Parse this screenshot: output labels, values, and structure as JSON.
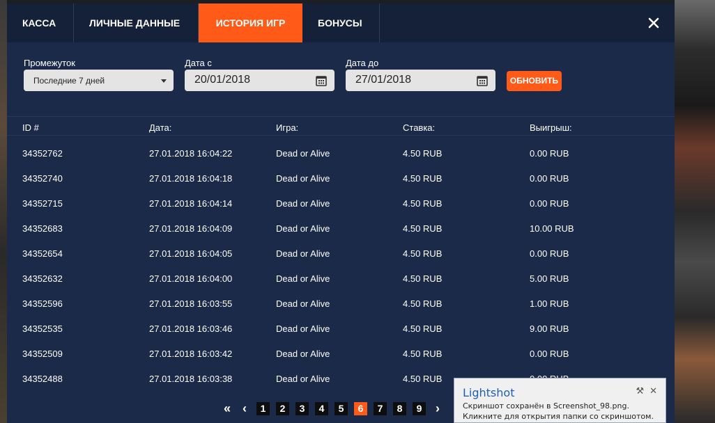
{
  "tabs": [
    {
      "label": "КАССА"
    },
    {
      "label": "ЛИЧНЫЕ ДАННЫЕ"
    },
    {
      "label": "ИСТОРИЯ ИГР"
    },
    {
      "label": "БОНУСЫ"
    }
  ],
  "active_tab": "ИСТОРИЯ ИГР",
  "filters": {
    "period_label": "Промежуток",
    "period_value": "Последние 7 дней",
    "date_from_label": "Дата с",
    "date_from_value": "20/01/2018",
    "date_to_label": "Дата до",
    "date_to_value": "27/01/2018",
    "refresh_label": "ОБНОВИТЬ"
  },
  "table": {
    "headers": [
      "ID #",
      "Дата:",
      "Игра:",
      "Ставка:",
      "Выигрыш:"
    ],
    "rows": [
      [
        "34352762",
        "27.01.2018 16:04:22",
        "Dead or Alive",
        "4.50 RUB",
        "0.00 RUB"
      ],
      [
        "34352740",
        "27.01.2018 16:04:18",
        "Dead or Alive",
        "4.50 RUB",
        "0.00 RUB"
      ],
      [
        "34352715",
        "27.01.2018 16:04:14",
        "Dead or Alive",
        "4.50 RUB",
        "0.00 RUB"
      ],
      [
        "34352683",
        "27.01.2018 16:04:09",
        "Dead or Alive",
        "4.50 RUB",
        "10.00 RUB"
      ],
      [
        "34352654",
        "27.01.2018 16:04:05",
        "Dead or Alive",
        "4.50 RUB",
        "0.00 RUB"
      ],
      [
        "34352632",
        "27.01.2018 16:04:00",
        "Dead or Alive",
        "4.50 RUB",
        "5.00 RUB"
      ],
      [
        "34352596",
        "27.01.2018 16:03:55",
        "Dead or Alive",
        "4.50 RUB",
        "1.00 RUB"
      ],
      [
        "34352535",
        "27.01.2018 16:03:46",
        "Dead or Alive",
        "4.50 RUB",
        "9.00 RUB"
      ],
      [
        "34352509",
        "27.01.2018 16:03:42",
        "Dead or Alive",
        "4.50 RUB",
        "0.00 RUB"
      ],
      [
        "34352488",
        "27.01.2018 16:03:38",
        "Dead or Alive",
        "4.50 RUB",
        "0.00 RUB"
      ]
    ]
  },
  "pagination": {
    "first": "«",
    "prev": "‹",
    "next": "›",
    "pages": [
      "1",
      "2",
      "3",
      "4",
      "5",
      "6",
      "7",
      "8",
      "9"
    ],
    "current": "6"
  },
  "toast": {
    "title": "Lightshot",
    "message": "Скриншот сохранён в Screenshot_98.png. Кликните для открытия папки со скриншотом."
  },
  "colors": {
    "accent": "#ff5a17",
    "panel": "#1b2a48",
    "tabbar": "#142138"
  },
  "icons": {
    "close": "close-icon",
    "calendar": "calendar-icon",
    "dropdown": "chevron-down-icon",
    "toast_settings": "wrench-icon",
    "toast_close": "close-icon"
  }
}
